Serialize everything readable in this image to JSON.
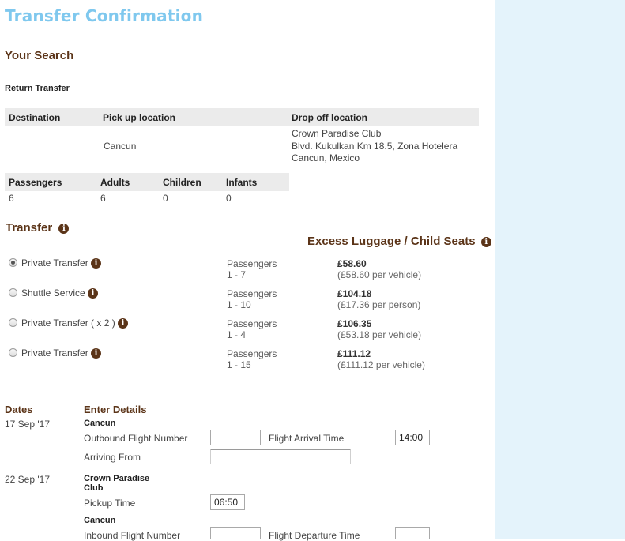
{
  "page": {
    "title": "Transfer Confirmation"
  },
  "search": {
    "heading": "Your Search",
    "type": "Return Transfer",
    "headers": {
      "destination": "Destination",
      "pickup": "Pick up location",
      "dropoff": "Drop off location"
    },
    "pickup_value": "Cancun",
    "dropoff_lines": [
      "Crown Paradise Club",
      "Blvd. Kukulkan Km 18.5, Zona Hotelera",
      "Cancun, Mexico"
    ],
    "pax_headers": [
      "Passengers",
      "Adults",
      "Children",
      "Infants"
    ],
    "pax_values": [
      "6",
      "6",
      "0",
      "0"
    ]
  },
  "transfer": {
    "heading": "Transfer",
    "luggage_heading": "Excess Luggage / Child Seats",
    "options": [
      {
        "label": "Private Transfer",
        "selected": true,
        "pax_label": "Passengers",
        "pax_range": "1 - 7",
        "price": "£58.60",
        "price_sub": "(£58.60 per vehicle)"
      },
      {
        "label": "Shuttle Service",
        "selected": false,
        "pax_label": "Passengers",
        "pax_range": "1 - 10",
        "price": "£104.18",
        "price_sub": "(£17.36 per person)"
      },
      {
        "label": "Private Transfer ( x 2 )",
        "selected": false,
        "pax_label": "Passengers",
        "pax_range": "1 - 4",
        "price": "£106.35",
        "price_sub": "(£53.18 per vehicle)"
      },
      {
        "label": "Private Transfer",
        "selected": false,
        "pax_label": "Passengers",
        "pax_range": "1 - 15",
        "price": "£111.12",
        "price_sub": "(£111.12 per vehicle)"
      }
    ]
  },
  "details": {
    "dates_heading": "Dates",
    "enter_heading": "Enter Details",
    "outbound": {
      "date": "17 Sep '17",
      "location": "Cancun",
      "flight_number_label": "Outbound Flight Number",
      "flight_number_value": "",
      "arrival_time_label": "Flight Arrival Time",
      "arrival_time_value": "14:00",
      "arriving_from_label": "Arriving From",
      "arriving_from_value": ""
    },
    "inbound": {
      "date": "22 Sep '17",
      "location_line1": "Crown Paradise",
      "location_line2": "Club",
      "pickup_time_label": "Pickup Time",
      "pickup_time_value": "06:50",
      "location2": "Cancun",
      "flight_number_label": "Inbound Flight Number",
      "flight_number_value": "",
      "departure_time_label": "Flight Departure Time",
      "departure_time_value": ""
    }
  }
}
